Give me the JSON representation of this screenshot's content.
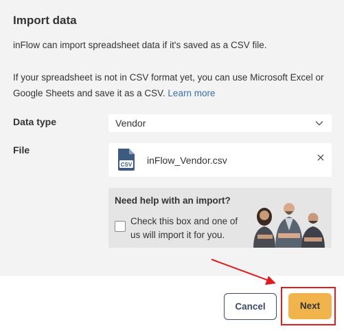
{
  "dialog": {
    "title": "Import data",
    "intro": "inFlow can import spreadsheet data if it's saved as a CSV file.",
    "info": "If your spreadsheet is not in CSV format yet, you can use Microsoft Excel or Google Sheets and save it as a CSV.",
    "learn_more": "Learn more"
  },
  "form": {
    "data_type_label": "Data type",
    "data_type_value": "Vendor",
    "file_label": "File",
    "file_name": "inFlow_Vendor.csv",
    "file_icon_text": "CSV"
  },
  "help": {
    "title": "Need help with an import?",
    "checkbox_text": "Check this box and one of us will import it for you.",
    "checked": false
  },
  "buttons": {
    "cancel": "Cancel",
    "next": "Next"
  },
  "colors": {
    "panel_bg": "#f3f3f3",
    "accent": "#f1b44c",
    "link": "#3a6ea5",
    "cancel_border": "#3e4a66",
    "highlight": "#e01b1b"
  }
}
